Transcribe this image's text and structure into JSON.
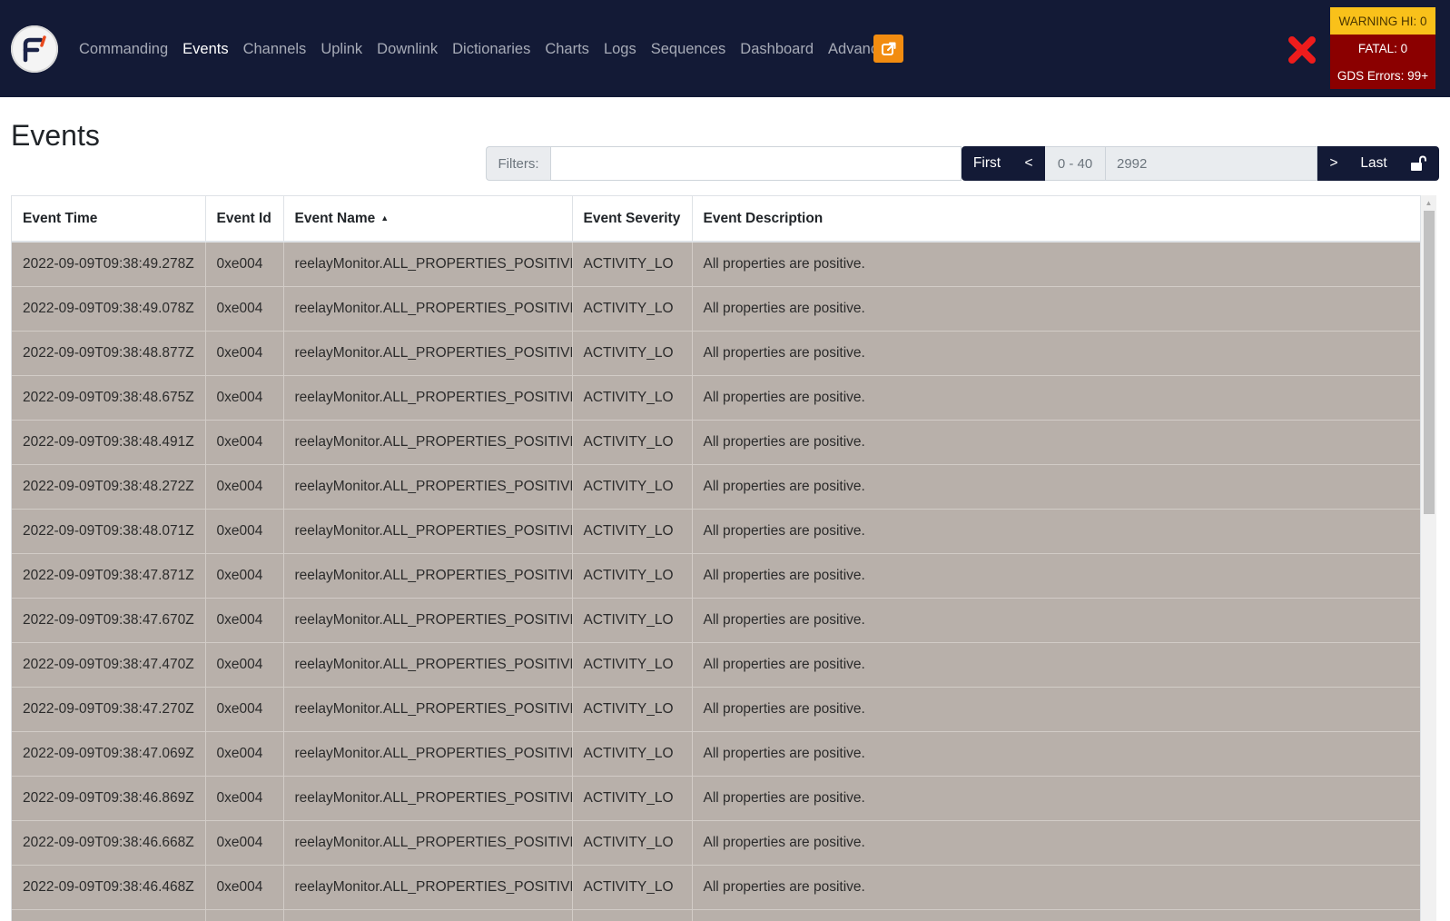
{
  "nav": {
    "items": [
      {
        "label": "Commanding",
        "active": false
      },
      {
        "label": "Events",
        "active": true
      },
      {
        "label": "Channels",
        "active": false
      },
      {
        "label": "Uplink",
        "active": false
      },
      {
        "label": "Downlink",
        "active": false
      },
      {
        "label": "Dictionaries",
        "active": false
      },
      {
        "label": "Charts",
        "active": false
      },
      {
        "label": "Logs",
        "active": false
      },
      {
        "label": "Sequences",
        "active": false
      },
      {
        "label": "Dashboard",
        "active": false
      },
      {
        "label": "Advanced",
        "active": false
      }
    ],
    "popout_icon": "external-link-icon",
    "status_icon": "red-x-icon"
  },
  "status": {
    "warning_hi": "WARNING HI: 0",
    "fatal": "FATAL: 0",
    "gds_errors": "GDS Errors: 99+"
  },
  "page": {
    "title": "Events"
  },
  "filter": {
    "label": "Filters:",
    "value": ""
  },
  "pagination": {
    "first_label": "First",
    "prev_label": "<",
    "range": "0 - 40",
    "total": "2992",
    "next_label": ">",
    "last_label": "Last",
    "lock_icon": "unlock-icon"
  },
  "table": {
    "columns": [
      {
        "label": "Event Time",
        "sort": ""
      },
      {
        "label": "Event Id",
        "sort": ""
      },
      {
        "label": "Event Name",
        "sort": "▲"
      },
      {
        "label": "Event Severity",
        "sort": ""
      },
      {
        "label": "Event Description",
        "sort": ""
      }
    ],
    "rows": [
      [
        "2022-09-09T09:38:49.278Z",
        "0xe004",
        "reelayMonitor.ALL_PROPERTIES_POSITIVE",
        "ACTIVITY_LO",
        "All properties are positive."
      ],
      [
        "2022-09-09T09:38:49.078Z",
        "0xe004",
        "reelayMonitor.ALL_PROPERTIES_POSITIVE",
        "ACTIVITY_LO",
        "All properties are positive."
      ],
      [
        "2022-09-09T09:38:48.877Z",
        "0xe004",
        "reelayMonitor.ALL_PROPERTIES_POSITIVE",
        "ACTIVITY_LO",
        "All properties are positive."
      ],
      [
        "2022-09-09T09:38:48.675Z",
        "0xe004",
        "reelayMonitor.ALL_PROPERTIES_POSITIVE",
        "ACTIVITY_LO",
        "All properties are positive."
      ],
      [
        "2022-09-09T09:38:48.491Z",
        "0xe004",
        "reelayMonitor.ALL_PROPERTIES_POSITIVE",
        "ACTIVITY_LO",
        "All properties are positive."
      ],
      [
        "2022-09-09T09:38:48.272Z",
        "0xe004",
        "reelayMonitor.ALL_PROPERTIES_POSITIVE",
        "ACTIVITY_LO",
        "All properties are positive."
      ],
      [
        "2022-09-09T09:38:48.071Z",
        "0xe004",
        "reelayMonitor.ALL_PROPERTIES_POSITIVE",
        "ACTIVITY_LO",
        "All properties are positive."
      ],
      [
        "2022-09-09T09:38:47.871Z",
        "0xe004",
        "reelayMonitor.ALL_PROPERTIES_POSITIVE",
        "ACTIVITY_LO",
        "All properties are positive."
      ],
      [
        "2022-09-09T09:38:47.670Z",
        "0xe004",
        "reelayMonitor.ALL_PROPERTIES_POSITIVE",
        "ACTIVITY_LO",
        "All properties are positive."
      ],
      [
        "2022-09-09T09:38:47.470Z",
        "0xe004",
        "reelayMonitor.ALL_PROPERTIES_POSITIVE",
        "ACTIVITY_LO",
        "All properties are positive."
      ],
      [
        "2022-09-09T09:38:47.270Z",
        "0xe004",
        "reelayMonitor.ALL_PROPERTIES_POSITIVE",
        "ACTIVITY_LO",
        "All properties are positive."
      ],
      [
        "2022-09-09T09:38:47.069Z",
        "0xe004",
        "reelayMonitor.ALL_PROPERTIES_POSITIVE",
        "ACTIVITY_LO",
        "All properties are positive."
      ],
      [
        "2022-09-09T09:38:46.869Z",
        "0xe004",
        "reelayMonitor.ALL_PROPERTIES_POSITIVE",
        "ACTIVITY_LO",
        "All properties are positive."
      ],
      [
        "2022-09-09T09:38:46.668Z",
        "0xe004",
        "reelayMonitor.ALL_PROPERTIES_POSITIVE",
        "ACTIVITY_LO",
        "All properties are positive."
      ],
      [
        "2022-09-09T09:38:46.468Z",
        "0xe004",
        "reelayMonitor.ALL_PROPERTIES_POSITIVE",
        "ACTIVITY_LO",
        "All properties are positive."
      ],
      [
        "",
        "",
        "",
        "",
        ""
      ]
    ]
  },
  "colors": {
    "navbar": "#131a36",
    "row_bg": "#b8b0aa",
    "warning": "#f9c11a",
    "fatal": "#8b0000",
    "accent_orange": "#f28c10"
  }
}
